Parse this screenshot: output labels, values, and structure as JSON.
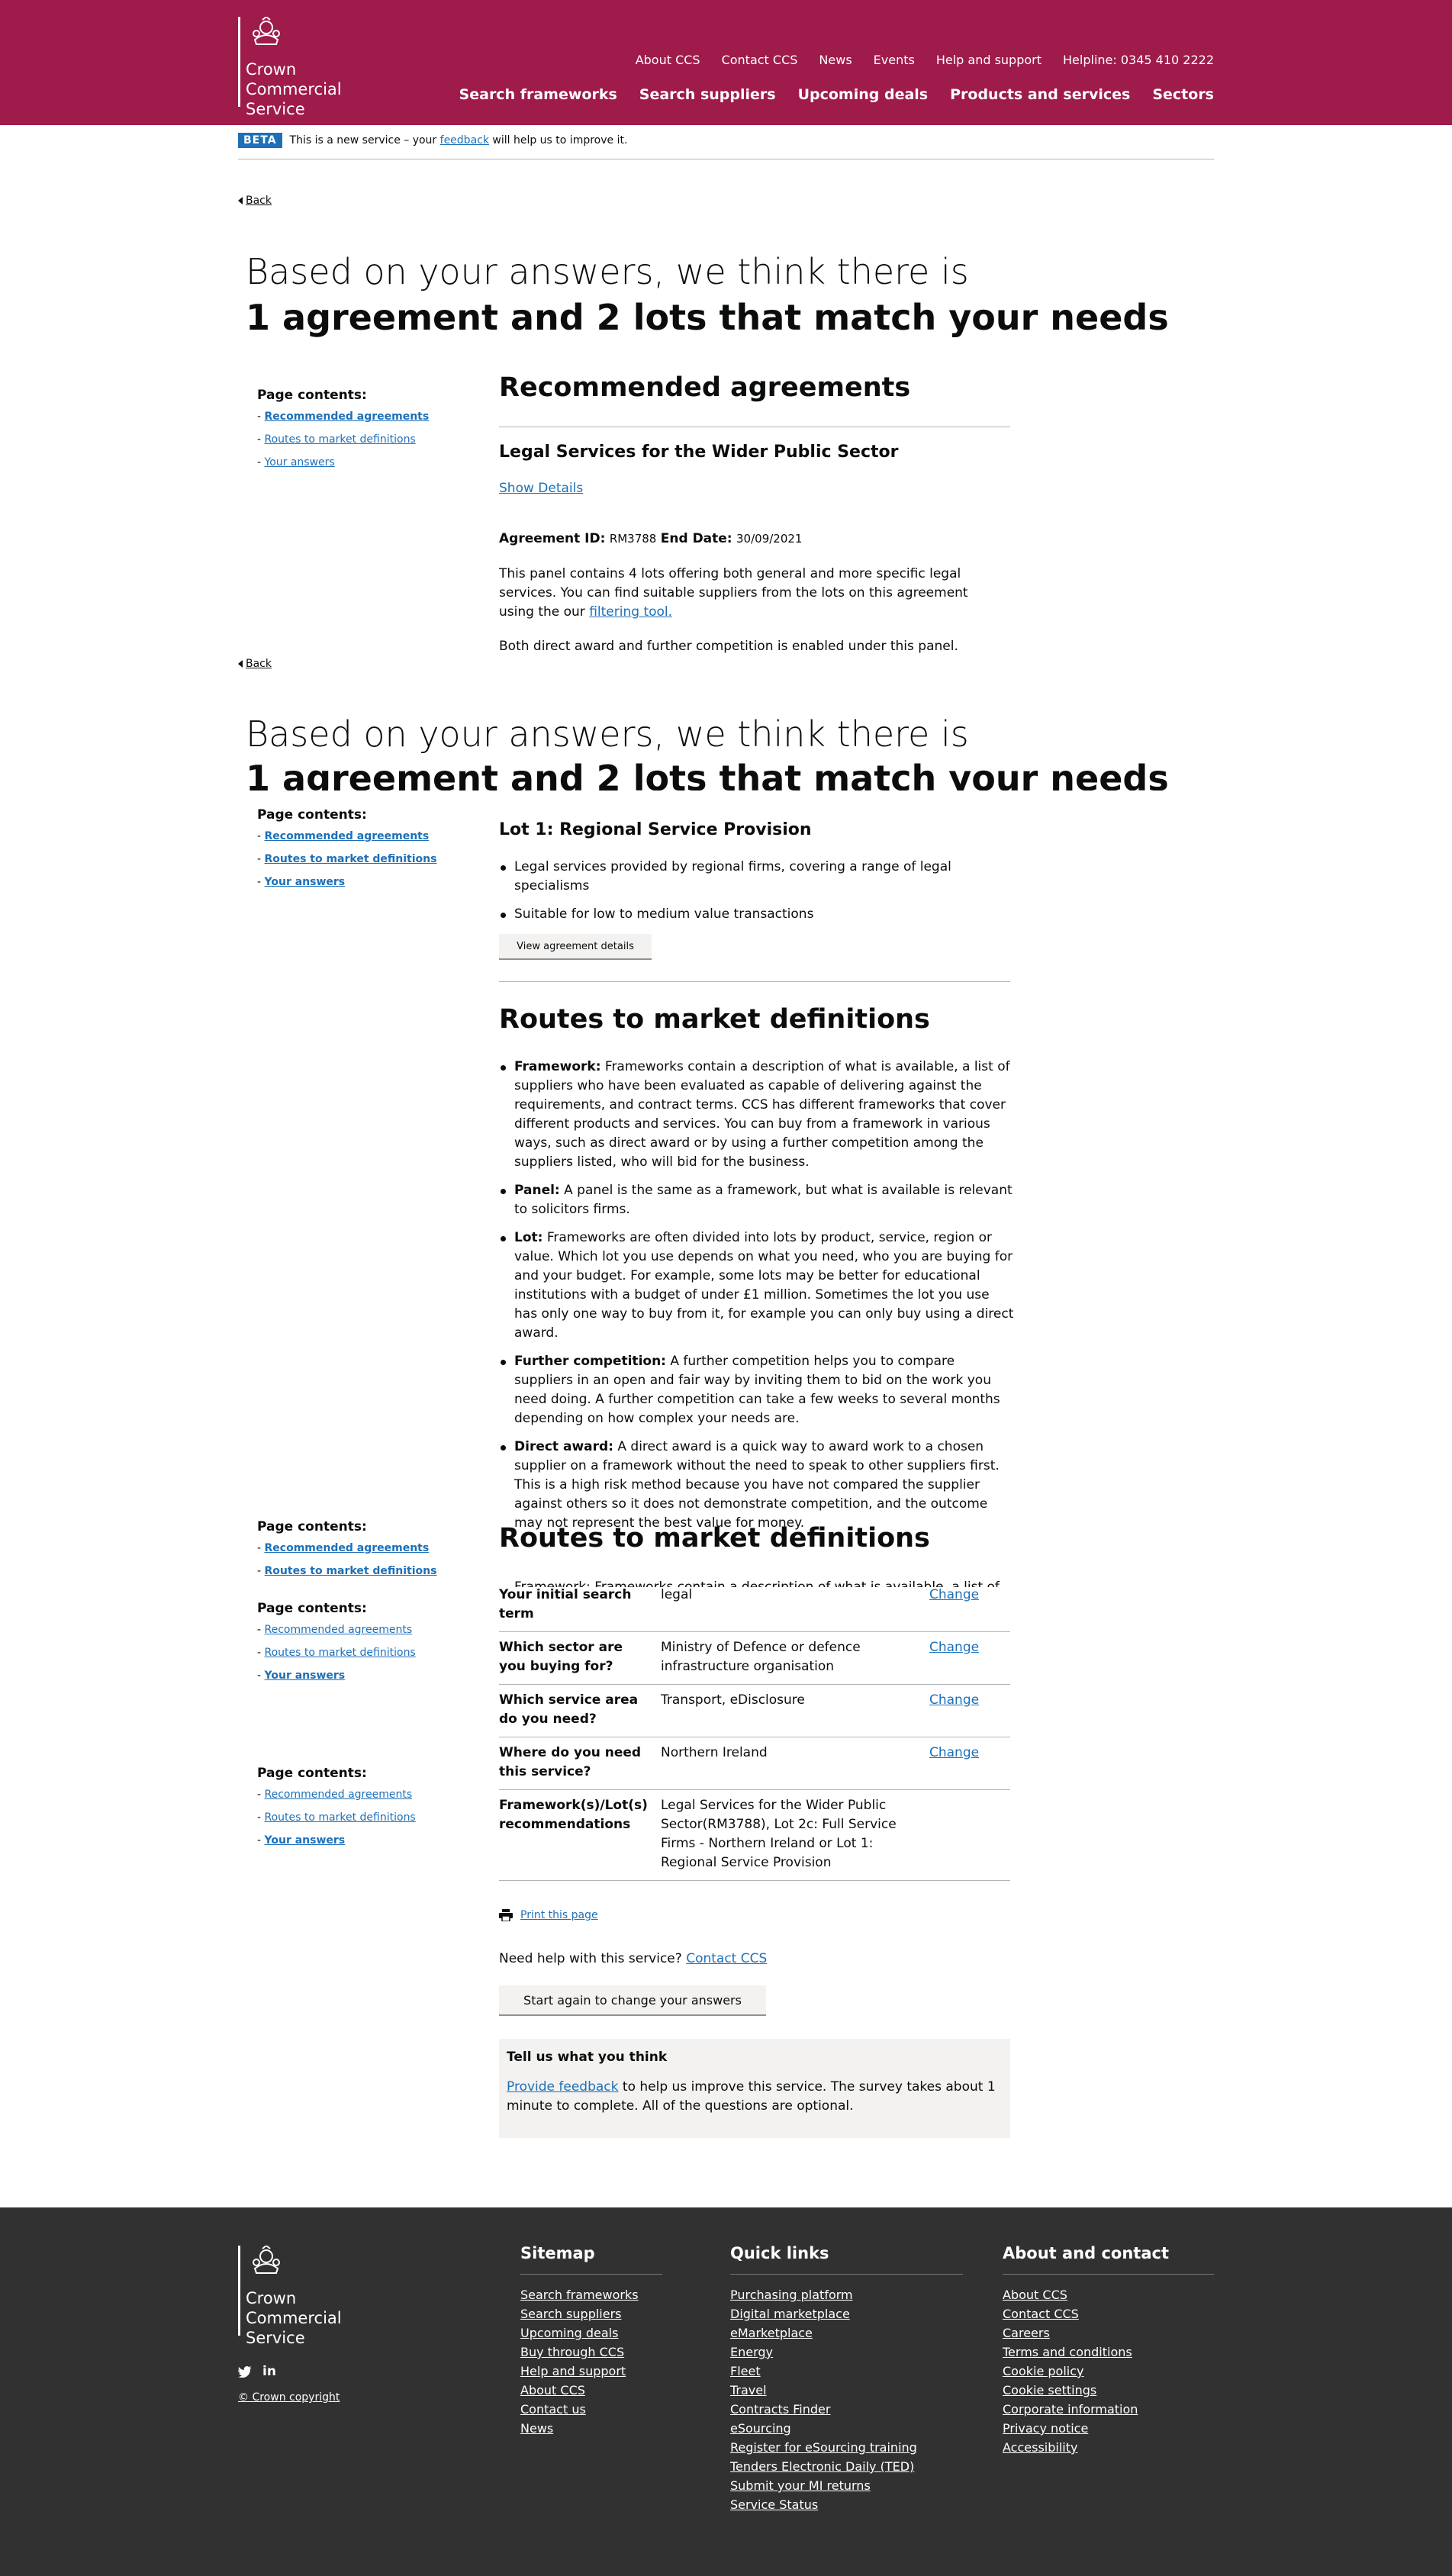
{
  "header": {
    "logo_lines": [
      "Crown",
      "Commercial",
      "Service"
    ],
    "top_nav": [
      "About CCS",
      "Contact CCS",
      "News",
      "Events",
      "Help and support",
      "Helpline: 0345 410 2222"
    ],
    "main_nav": [
      "Search frameworks",
      "Search suppliers",
      "Upcoming deals",
      "Products and services",
      "Sectors"
    ]
  },
  "beta": {
    "tag": "BETA",
    "before": "This is a new service – your ",
    "link": "feedback",
    "after": " will help us to improve it."
  },
  "back_label": "Back",
  "hero": {
    "line1": "Based on your answers, we think there is",
    "line2": "1 agreement and 2 lots that match your needs"
  },
  "page_contents": {
    "heading": "Page contents:",
    "items": [
      "Recommended agreements",
      "Routes to market definitions",
      "Your answers"
    ]
  },
  "recommended": {
    "heading": "Recommended agreements",
    "agreement_title": "Legal Services for the Wider Public Sector",
    "show_details": "Show Details",
    "agreement_id_label": "Agreement ID:",
    "agreement_id": "RM3788",
    "end_date_label": "End Date:",
    "end_date": "30/09/2021",
    "desc1_before": "This panel contains 4 lots offering both general and more specific legal services. You can find suitable suppliers from the lots on this agreement using the our ",
    "desc1_link": "filtering tool.",
    "desc2": "Both direct award and further competition is enabled under this panel."
  },
  "lot": {
    "title": "Lot 1: Regional Service Provision",
    "bullets": [
      "Legal services provided by regional firms, covering a range of legal specialisms",
      "Suitable for low to medium value transactions"
    ],
    "button": "View agreement details"
  },
  "routes": {
    "heading": "Routes to market definitions",
    "items": [
      {
        "term": "Framework:",
        "text": " Frameworks contain a description of what is available, a list of suppliers who have been evaluated as capable of delivering against the requirements, and contract terms. CCS has different frameworks that cover different products and services. You can buy from a framework in various ways, such as direct award or by using a further competition among the suppliers listed, who will bid for the business."
      },
      {
        "term": "Panel:",
        "text": " A panel is the same as a framework, but what is available is relevant to solicitors firms."
      },
      {
        "term": "Lot:",
        "text": " Frameworks are often divided into lots by product, service, region or value. Which lot you use depends on what you need, who you are buying for and your budget. For example, some lots may be better for educational institutions with a budget of under £1 million. Sometimes the lot you use has only one way to buy from it, for example you can only buy using a direct award."
      },
      {
        "term": "Further competition:",
        "text": " A further competition helps you to compare suppliers in an open and fair way by inviting them to bid on the work you need doing. A further competition can take a few weeks to several months depending on how complex your needs are."
      },
      {
        "term": "Direct award:",
        "text": " A direct award is a quick way to award work to a chosen supplier on a framework without the need to speak to other suppliers first. This is a high risk method because you have not compared the supplier against others so it does not demonstrate competition, and the outcome may not represent the best value for money."
      }
    ],
    "ghost_text": "Framework: Frameworks contain a description of what is available, a list of"
  },
  "answers": {
    "change_label": "Change",
    "rows": [
      {
        "q": "Your initial search term",
        "a": "legal",
        "change": true
      },
      {
        "q": "Which sector are you buying for?",
        "a": "Ministry of Defence or defence infrastructure organisation",
        "change": true
      },
      {
        "q": "Which service area do you need?",
        "a": "Transport, eDisclosure",
        "change": true
      },
      {
        "q": "Where do you need this service?",
        "a": "Northern Ireland",
        "change": true
      },
      {
        "q": "Framework(s)/Lot(s) recommendations",
        "a": "Legal Services for the Wider Public Sector(RM3788), Lot 2c: Full Service Firms - Northern Ireland or Lot 1: Regional Service Provision",
        "change": false
      }
    ]
  },
  "print_label": "Print this page",
  "help": {
    "text": "Need help with this service? ",
    "link": "Contact CCS"
  },
  "start_again": "Start again to change your answers",
  "feedback": {
    "title": "Tell us what you think",
    "link": "Provide feedback",
    "text": " to help us improve this service. The survey takes about 1 minute to complete. All of the questions are optional."
  },
  "footer": {
    "sitemap": {
      "heading": "Sitemap",
      "links": [
        "Search frameworks",
        "Search suppliers",
        "Upcoming deals",
        "Buy through CCS",
        "Help and support",
        "About CCS",
        "Contact us",
        "News"
      ]
    },
    "quick": {
      "heading": "Quick links",
      "links": [
        "Purchasing platform",
        "Digital marketplace",
        "eMarketplace",
        "Energy",
        "Fleet",
        "Travel",
        "Contracts Finder",
        "eSourcing",
        "Register for eSourcing training",
        "Tenders Electronic Daily (TED)",
        "Submit your MI returns",
        "Service Status"
      ]
    },
    "about": {
      "heading": "About and contact",
      "links": [
        "About CCS",
        "Contact CCS",
        "Careers",
        "Terms and conditions",
        "Cookie policy",
        "Cookie settings",
        "Corporate information",
        "Privacy notice",
        "Accessibility"
      ]
    },
    "social": "in",
    "copyright": "© Crown copyright"
  }
}
